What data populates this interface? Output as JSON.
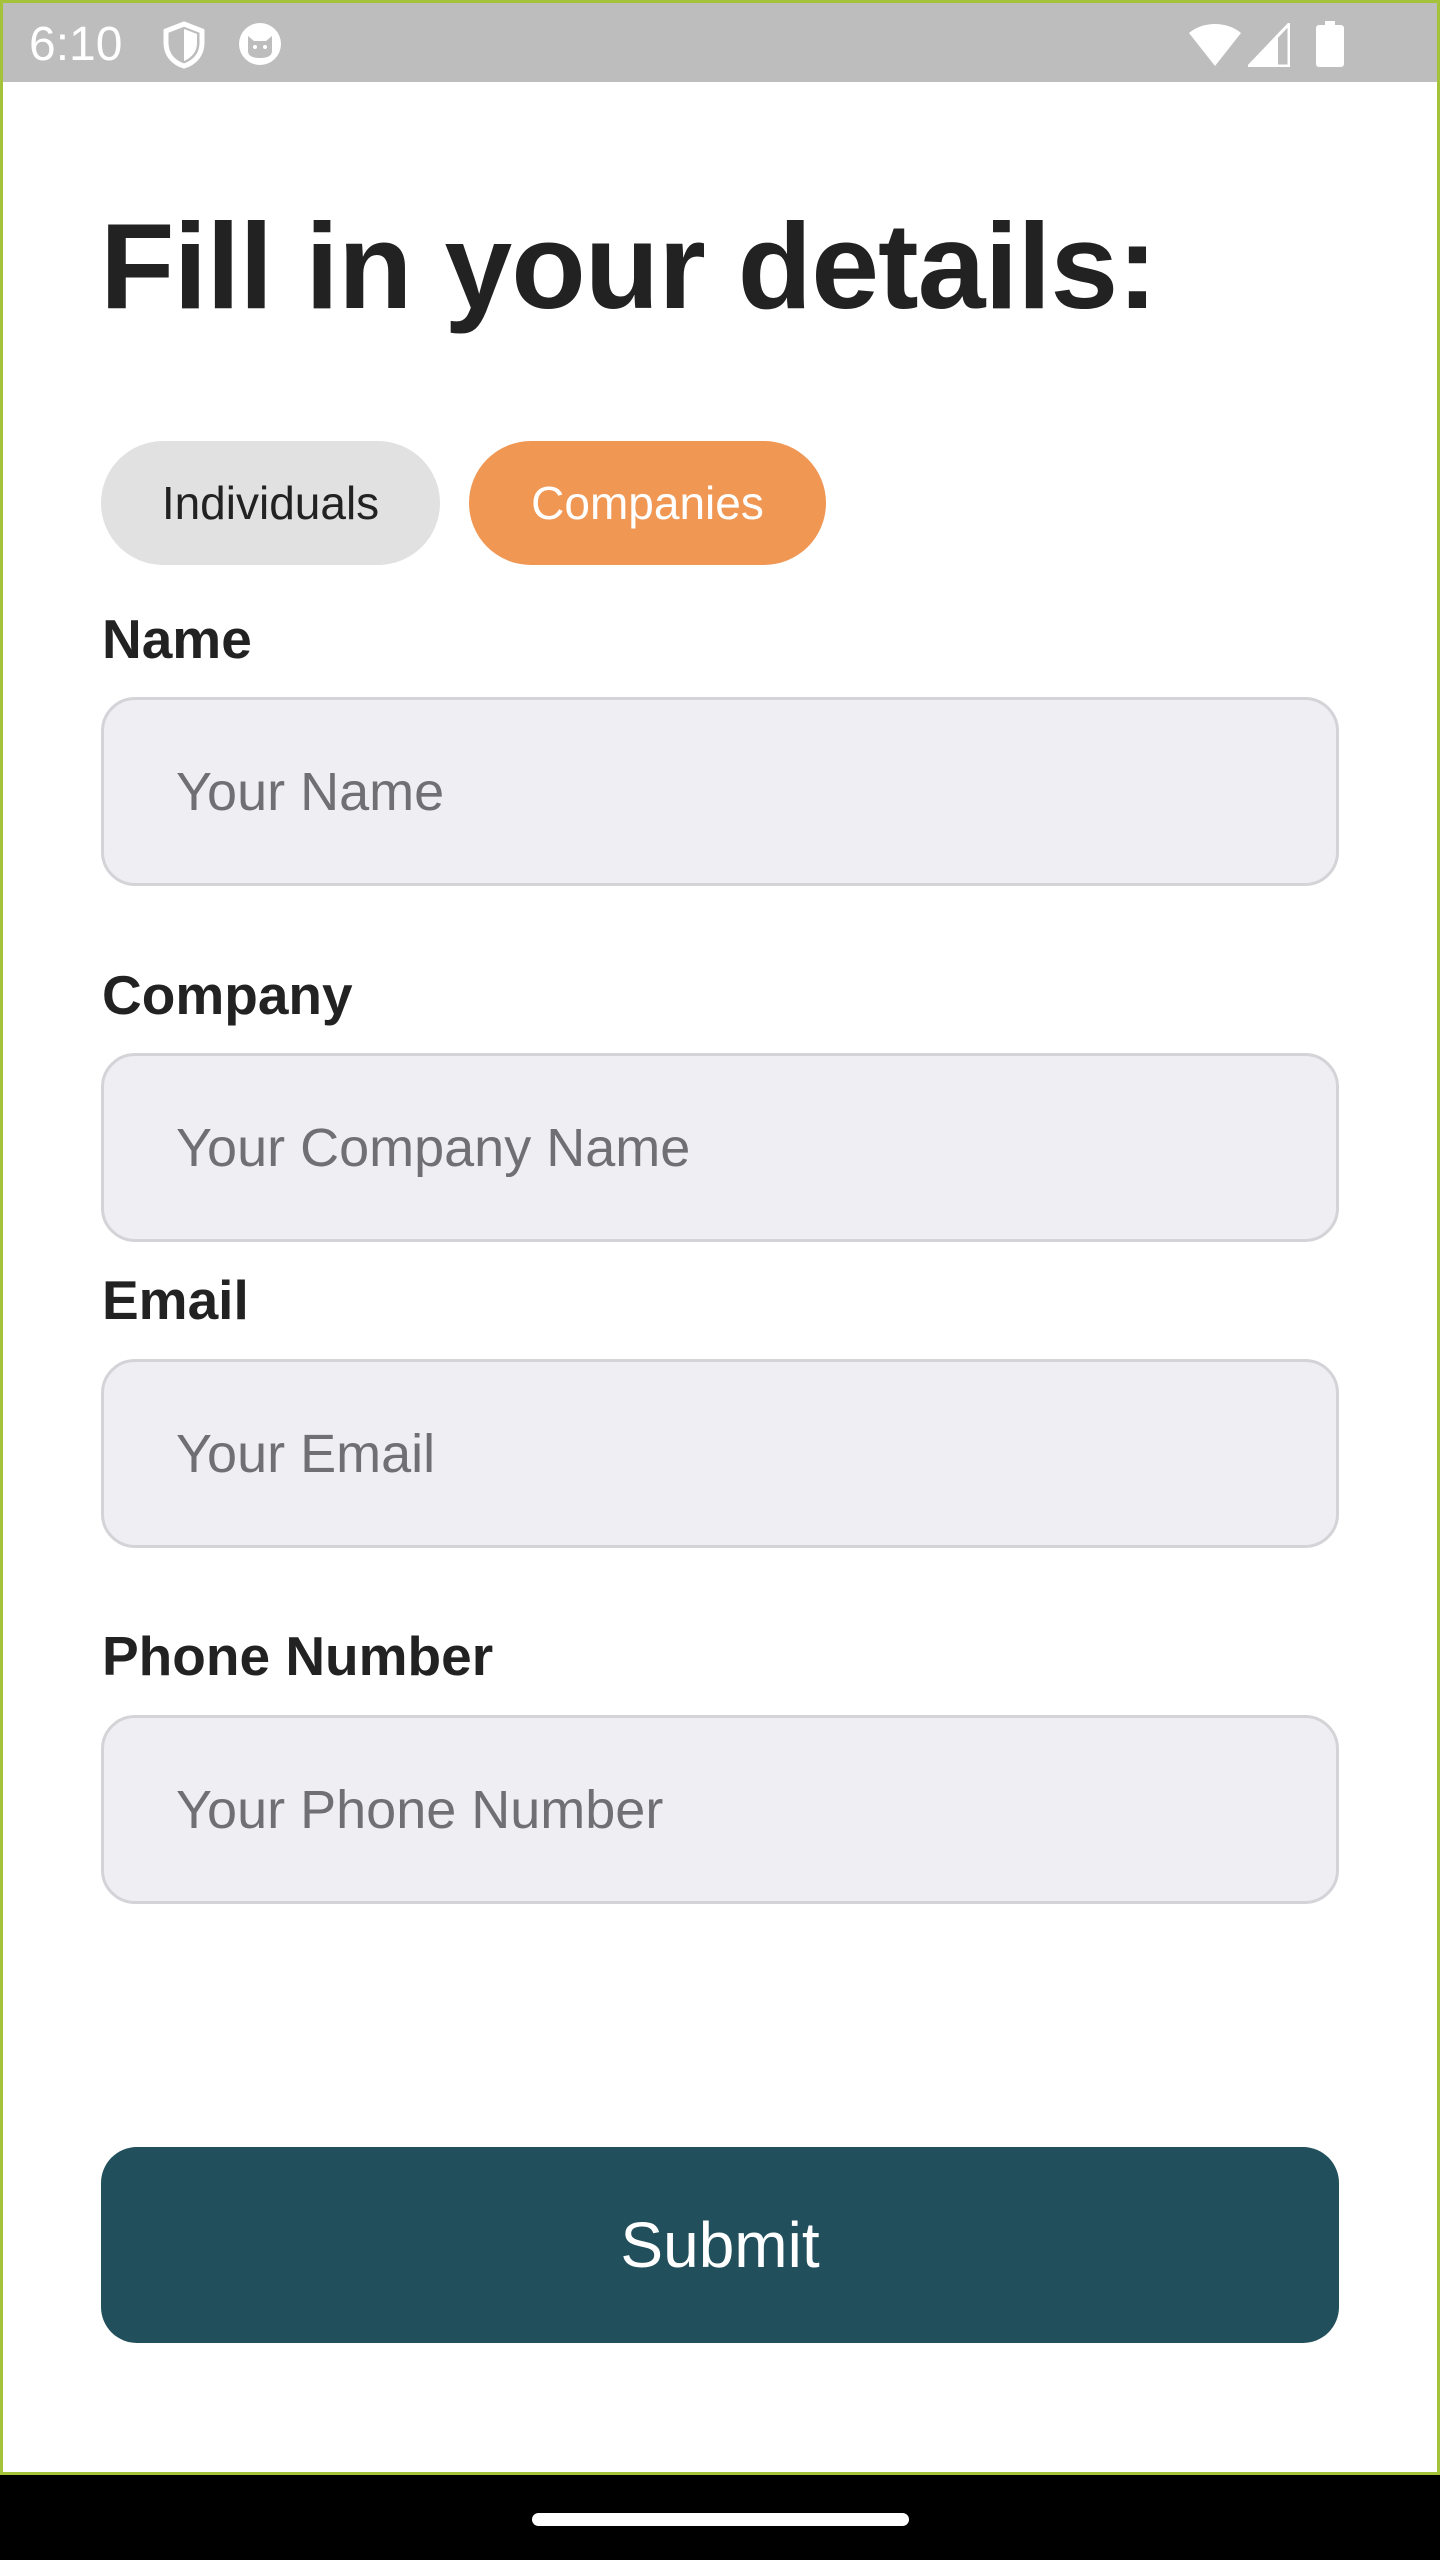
{
  "status_bar": {
    "time": "6:10",
    "icons": [
      "shield-icon",
      "cat-icon",
      "wifi-icon",
      "signal-icon",
      "battery-icon"
    ]
  },
  "form": {
    "title": "Fill in your details:",
    "segments": [
      {
        "label": "Individuals",
        "selected": false
      },
      {
        "label": "Companies",
        "selected": true
      }
    ],
    "fields": [
      {
        "label": "Name",
        "placeholder": "Your Name",
        "value": ""
      },
      {
        "label": "Company",
        "placeholder": "Your Company Name",
        "value": ""
      },
      {
        "label": "Email",
        "placeholder": "Your Email",
        "value": ""
      },
      {
        "label": "Phone Number",
        "placeholder": "Your Phone Number",
        "value": ""
      }
    ],
    "submit_label": "Submit"
  },
  "colors": {
    "accent": "#f09754",
    "primary": "#224f5c",
    "segment_inactive": "#e1e1e1",
    "input_background": "#efeff3",
    "status_bar": "#bdbdbd"
  }
}
